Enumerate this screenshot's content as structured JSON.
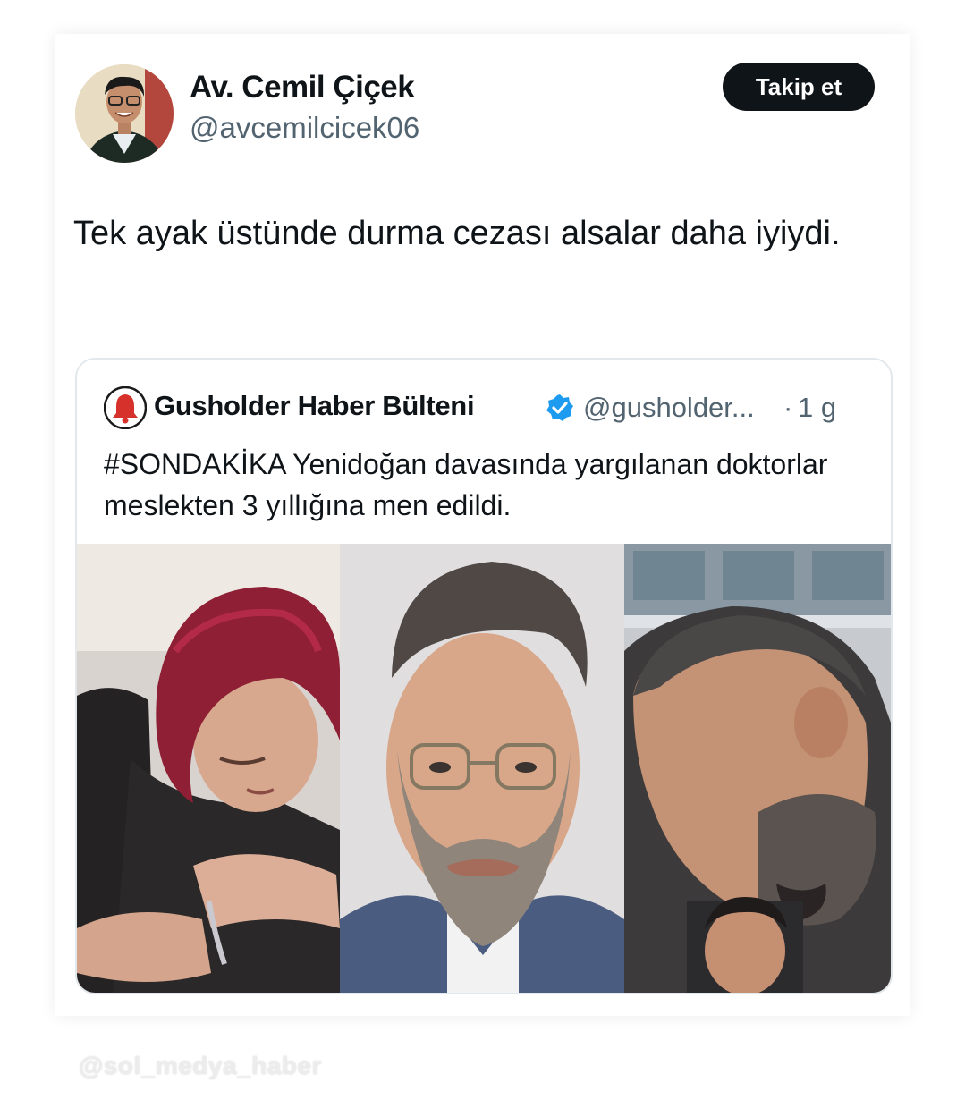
{
  "tweet": {
    "author": {
      "display_name": "Av. Cemil Çiçek",
      "handle": "@avcemilcicek06"
    },
    "follow_label": "Takip et",
    "text": "Tek ayak üstünde durma cezası alsalar daha iyiydi."
  },
  "quoted_tweet": {
    "author_name": "Gusholder Haber Bülteni",
    "verified": true,
    "handle": "@gusholder...",
    "separator": "·",
    "time": "1 g",
    "text": "#SONDAKİKA Yenidoğan davasında yargılanan doktorlar meslekten 3 yıllığına men edildi.",
    "media": [
      "photo-woman-red-hair",
      "photo-man-glasses-beard",
      "photo-man-bowing-head"
    ]
  },
  "watermark": "@sol_medya_haber",
  "colors": {
    "text_primary": "#0f1419",
    "text_secondary": "#536471",
    "button_bg": "#0f1419",
    "verified_blue": "#1d9bf0",
    "border": "#e3e8ec"
  }
}
